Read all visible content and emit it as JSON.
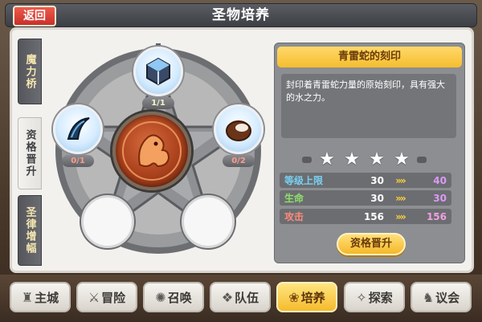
{
  "header": {
    "back_label": "返回",
    "title": "圣物培养"
  },
  "side_tabs": [
    {
      "label": "魔力桥",
      "active": false
    },
    {
      "label": "资格晋升",
      "active": true
    },
    {
      "label": "圣律增幅",
      "active": false
    }
  ],
  "diagram": {
    "center_icon": "dragon-emblem-icon",
    "nodes": [
      {
        "id": "top",
        "icon": "cube-icon",
        "badge": "1/1"
      },
      {
        "id": "left",
        "icon": "horn-icon",
        "badge": "0/1"
      },
      {
        "id": "right",
        "icon": "coconut-icon",
        "badge": "0/2"
      },
      {
        "id": "bottom-left",
        "icon": "",
        "badge": ""
      },
      {
        "id": "bottom-right",
        "icon": "",
        "badge": ""
      }
    ]
  },
  "item": {
    "name": "青雷蛇的刻印",
    "description": "封印着青雷蛇力量的原始刻印，具有强大的水之力。",
    "stars": 4
  },
  "stats": [
    {
      "label": "等级上限",
      "current": "30",
      "next": "40",
      "color": "#7ad0f0"
    },
    {
      "label": "生命",
      "current": "30",
      "next": "30",
      "color": "#8ee06a"
    },
    {
      "label": "攻击",
      "current": "156",
      "next": "156",
      "color": "#ff8a7a"
    }
  ],
  "arrow_glyph": "»»",
  "upgrade_button": "资格晋升",
  "bottom_nav": [
    {
      "label": "主城",
      "icon": "castle-icon",
      "glyph": "♜",
      "active": false
    },
    {
      "label": "冒险",
      "icon": "swords-icon",
      "glyph": "⚔",
      "active": false
    },
    {
      "label": "召唤",
      "icon": "summon-circle-icon",
      "glyph": "✺",
      "active": false
    },
    {
      "label": "队伍",
      "icon": "team-icon",
      "glyph": "❖",
      "active": false
    },
    {
      "label": "培养",
      "icon": "cultivate-icon",
      "glyph": "❀",
      "active": true
    },
    {
      "label": "探索",
      "icon": "explore-icon",
      "glyph": "✧",
      "active": false
    },
    {
      "label": "议会",
      "icon": "council-icon",
      "glyph": "♞",
      "active": false
    }
  ],
  "colors": {
    "accent_gold": "#f5bd2e",
    "back_red": "#c8302a",
    "panel_bg": "#f3f1ee"
  }
}
